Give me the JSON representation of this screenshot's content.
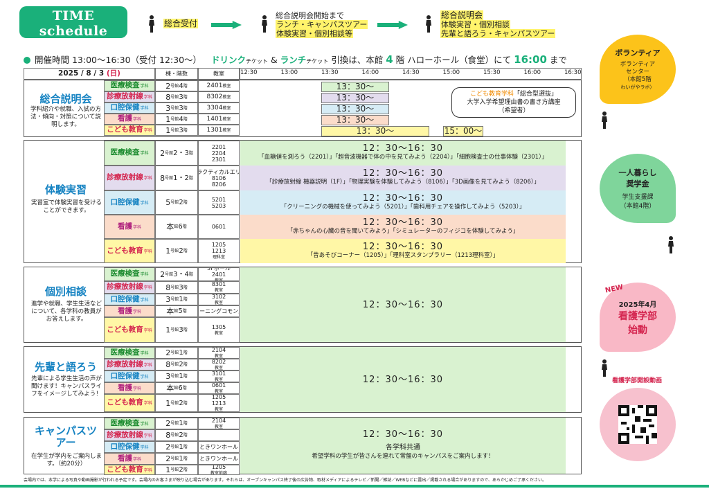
{
  "header": {
    "title": "TIME schedule",
    "subtitle": "タイムスケジュール"
  },
  "flow": [
    {
      "l1": "総合受付",
      "l2": "",
      "l3": ""
    },
    {
      "l1": "総合説明会開始まで",
      "l2": "ランチ・キャンパスツアー",
      "l3": "体験実習・個別相談等"
    },
    {
      "l1": "総合説明会",
      "l2": "体験実習・個別相談",
      "l3": "先輩と語ろう・キャンパスツアー"
    }
  ],
  "info": {
    "a": "開催時間 13:00〜16:30（受付 12:30〜）",
    "b": "ドリンク",
    "c": "チケット",
    "d": "&",
    "e": "ランチ",
    "f": "引換は、本館",
    "g": "4",
    "h": "階 ハローホール（食堂）にて",
    "i": "16:00",
    "j": "まで"
  },
  "table_head": {
    "date_y": "2025 / 8 / 3",
    "date_dow": "(日)",
    "bldg": "棟・階数",
    "room": "教室",
    "times": [
      "12:30",
      "13:00",
      "13:30",
      "14:00",
      "14:30",
      "15:00",
      "15:30",
      "16:00",
      "16:30"
    ]
  },
  "dept_suffix": "学科",
  "s1": {
    "title": "総合説明会",
    "desc": "学科紹介や就職、入試の方法・傾向・対策について説明します。",
    "rows": [
      {
        "dept": "医療検査",
        "b1": "2",
        "b2": "号館",
        "b3": "4",
        "b4": "階",
        "room": "2401",
        "ru": "教室",
        "time": "13：30〜"
      },
      {
        "dept": "診療放射線",
        "b1": "8",
        "b2": "号館",
        "b3": "3",
        "b4": "階",
        "room": "8302",
        "ru": "教室",
        "time": "13：30〜"
      },
      {
        "dept": "口腔保健",
        "b1": "3",
        "b2": "号館",
        "b3": "3",
        "b4": "階",
        "room": "3304",
        "ru": "教室",
        "time": "13：30〜"
      },
      {
        "dept": "看護",
        "b1": "1",
        "b2": "号館",
        "b3": "4",
        "b4": "階",
        "room": "1401",
        "ru": "教室",
        "time": "13：30〜"
      },
      {
        "dept": "こども教育",
        "b1": "1",
        "b2": "号館",
        "b3": "3",
        "b4": "階",
        "room": "1301",
        "ru": "教室",
        "time": "13：30〜",
        "time2": "15：00〜"
      }
    ],
    "callout": {
      "a": "こども教育学科",
      "b": "「総合型選抜」",
      "c": "大学入学希望理由書の書き方講座",
      "d": "（希望者）"
    }
  },
  "s2": {
    "title": "体験実習",
    "desc": "実習室で体験実習を受けることができます。",
    "rows": [
      {
        "dept": "医療検査",
        "b1": "2",
        "b2": "号館",
        "b3": "2・3",
        "b4": "階",
        "r1": "2201",
        "r2": "2204",
        "r3": "2301",
        "ru": "教室",
        "time": "12：30〜16：30",
        "act": "「血糖値を測ろう（2201）」「超音波機器で体の中を見てみよう（2204）」「細胞検査士の仕事体験（2301）」"
      },
      {
        "dept": "診療放射線",
        "b1": "8",
        "b2": "号館",
        "b3": "1・2",
        "b4": "階",
        "r1": "プラクティカルエリア",
        "r2": "8106",
        "r3": "8206",
        "ru": "教室",
        "time": "12：30〜16：30",
        "act": "「診療放射線 機器説明（1F）」「物理実験を体験してみよう（8106）」「3D画像を見てみよう（8206）」"
      },
      {
        "dept": "口腔保健",
        "b1": "5",
        "b2": "号館",
        "b3": "2",
        "b4": "階",
        "r1": "5201",
        "r2": "5203",
        "ru": "教室",
        "time": "12：30〜16：30",
        "act": "「クリーニングの機械を使ってみよう（5201）」「歯科用チェアを操作してみよう（5203）」"
      },
      {
        "dept": "看護",
        "b1": "本",
        "b2": "館",
        "b3": "6",
        "b4": "階",
        "r1": "0601",
        "ru": "教室",
        "time": "12：30〜16：30",
        "act": "「赤ちゃんの心臓の音を聞いてみよう」「シミュレーターのフィジコを体験してみよう」"
      },
      {
        "dept": "こども教育",
        "b1": "1",
        "b2": "号館",
        "b3": "2",
        "b4": "階",
        "r1": "1205",
        "r2": "1213",
        "ru": "教室",
        "ru2": "理科室",
        "time": "12：30〜16：30",
        "act": "「昔あそびコーナー（1205）」「理科室スタンプラリー（1213理科室）」"
      }
    ]
  },
  "s3": {
    "title": "個別相談",
    "desc": "進学や就職、学生生活などについて、各学科の教員がお答えします。",
    "time": "12：30〜16：30",
    "rows": [
      {
        "dept": "医療検査",
        "b1": "2",
        "b2": "号館",
        "b3": "3・4",
        "b4": "階",
        "r1": "3Fホール",
        "r2": "2401",
        "ru": "教室"
      },
      {
        "dept": "診療放射線",
        "b1": "8",
        "b2": "号館",
        "b3": "3",
        "b4": "階",
        "r1": "8301",
        "ru": "教室"
      },
      {
        "dept": "口腔保健",
        "b1": "3",
        "b2": "号館",
        "b3": "1",
        "b4": "階",
        "r1": "3102",
        "ru": "教室"
      },
      {
        "dept": "看護",
        "b1": "本",
        "b2": "館",
        "b3": "5",
        "b4": "階",
        "r1": "ラーニングコモンズ"
      },
      {
        "dept": "こども教育",
        "b1": "1",
        "b2": "号館",
        "b3": "3",
        "b4": "階",
        "r1": "1305",
        "ru": "教室"
      }
    ]
  },
  "s4": {
    "title": "先輩と語ろう",
    "desc": "先輩による学生生活の声が聞けます！キャンパスライフをイメージしてみよう！",
    "time": "12：30〜16：30",
    "rows": [
      {
        "dept": "医療検査",
        "b1": "2",
        "b2": "号館",
        "b3": "1",
        "b4": "階",
        "r1": "2104",
        "ru": "教室"
      },
      {
        "dept": "診療放射線",
        "b1": "8",
        "b2": "号館",
        "b3": "2",
        "b4": "階",
        "r1": "8202",
        "ru": "教室"
      },
      {
        "dept": "口腔保健",
        "b1": "3",
        "b2": "号館",
        "b3": "1",
        "b4": "階",
        "r1": "3101",
        "ru": "教室"
      },
      {
        "dept": "看護",
        "b1": "本",
        "b2": "館",
        "b3": "6",
        "b4": "階",
        "r1": "0601",
        "ru": "教室"
      },
      {
        "dept": "こども教育",
        "b1": "1",
        "b2": "号館",
        "b3": "2",
        "b4": "階",
        "r1": "1205",
        "r2": "1213",
        "ru": "教室"
      }
    ]
  },
  "s5": {
    "title": "キャンパスツアー",
    "desc": "在学生が学内をご案内します。（約20分）",
    "time": "12：30〜16：30",
    "t2": "各学科共通",
    "t3": "希望学科の学生が皆さんを連れて常盤のキャンパスをご案内します！",
    "rows": [
      {
        "dept": "医療検査",
        "b1": "2",
        "b2": "号館",
        "b3": "1",
        "b4": "階",
        "r1": "2104",
        "ru": "教室"
      },
      {
        "dept": "診療放射線",
        "b1": "8",
        "b2": "号館",
        "b3": "2",
        "b4": "階"
      },
      {
        "dept": "口腔保健",
        "b1": "2",
        "b2": "号館",
        "b3": "1",
        "b4": "階",
        "r1": "ときワンホール"
      },
      {
        "dept": "看護",
        "b1": "2",
        "b2": "号館",
        "b3": "1",
        "b4": "階",
        "r1": "ときワンホール"
      },
      {
        "dept": "こども教育",
        "b1": "1",
        "b2": "号館",
        "b3": "2",
        "b4": "階",
        "r1": "1205",
        "ru": "教室前廊"
      }
    ]
  },
  "side": {
    "v": {
      "t": "ボランティア",
      "a": "ボランティア",
      "b": "センター",
      "c": "（本館5階",
      "d": "わいがやラボ）"
    },
    "s": {
      "t": "一人暮らし",
      "t2": "奨学金",
      "a": "学生支援課",
      "b": "（本館4階）"
    },
    "n": {
      "new": "NEW",
      "a": "2025年4月",
      "b": "看護学部",
      "c": "始動"
    },
    "video": "看護学部開設動画"
  },
  "footer": "会場内では、本学による写真や動画撮影が行われる予定です。会場内のお客さまが映り込む場合があります。それらは、オープンキャンパス終了後の広告物、取材メディアによるテレビ／新聞／雑誌／WEBなどに露出／掲載される場合がありますので、あらかじめご了承ください。",
  "colors": {
    "brand": "#1ab07a",
    "nurse": "#d4254f",
    "blue": "#1683c2"
  }
}
